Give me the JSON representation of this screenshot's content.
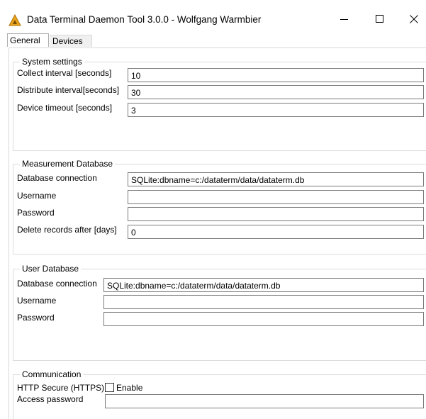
{
  "window": {
    "title": "Data Terminal Daemon Tool  3.0.0 - Wolfgang Warmbier",
    "app_icon": "warning-triangle-icon"
  },
  "tabs": [
    {
      "label": "General",
      "selected": true
    },
    {
      "label": "Devices",
      "selected": false
    }
  ],
  "system_settings": {
    "title": "System settings",
    "collect_interval_label": "Collect interval [seconds]",
    "collect_interval_value": "10",
    "distribute_interval_label": "Distribute interval[seconds]",
    "distribute_interval_value": "30",
    "device_timeout_label": "Device timeout [seconds]",
    "device_timeout_value": "3"
  },
  "measurement_database": {
    "title": "Measurement Database",
    "connection_label": "Database connection",
    "connection_value": "SQLite:dbname=c:/dataterm/data/dataterm.db",
    "username_label": "Username",
    "username_value": "",
    "password_label": "Password",
    "password_value": "",
    "delete_after_label": "Delete records after [days]",
    "delete_after_value": "0"
  },
  "user_database": {
    "title": "User Database",
    "connection_label": "Database connection",
    "connection_value": "SQLite:dbname=c:/dataterm/data/dataterm.db",
    "username_label": "Username",
    "username_value": "",
    "password_label": "Password",
    "password_value": ""
  },
  "communication": {
    "title": "Communication",
    "https_label": "HTTP Secure (HTTPS)",
    "https_enable_label": "Enable",
    "https_enabled": false,
    "access_password_label": "Access password",
    "access_password_value": ""
  },
  "colors": {
    "icon_fill": "#e8a31c",
    "window_bg": "#ffffff",
    "field_border": "#7a7a7a",
    "group_border": "#dcdcdc"
  }
}
